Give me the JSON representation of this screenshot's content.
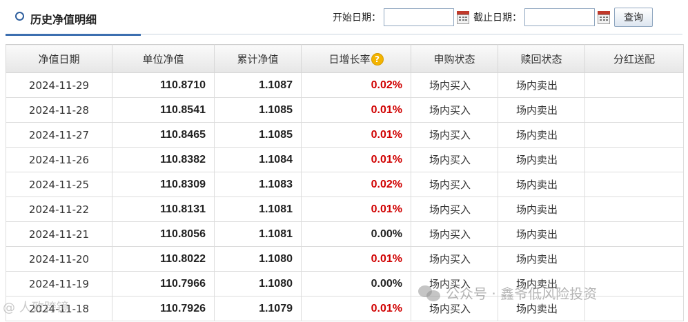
{
  "header": {
    "title": "历史净值明细",
    "start_label": "开始日期：",
    "end_label": "截止日期：",
    "start_value": "",
    "end_value": "",
    "query_label": "查询"
  },
  "table": {
    "columns": [
      "净值日期",
      "单位净值",
      "累计净值",
      "日增长率",
      "申购状态",
      "赎回状态",
      "分红送配"
    ],
    "help_glyph": "?",
    "rows": [
      {
        "date": "2024-11-29",
        "unit": "110.8710",
        "acc": "1.1087",
        "rate": "0.02%",
        "buy": "场内买入",
        "sell": "场内卖出",
        "div": ""
      },
      {
        "date": "2024-11-28",
        "unit": "110.8541",
        "acc": "1.1085",
        "rate": "0.01%",
        "buy": "场内买入",
        "sell": "场内卖出",
        "div": ""
      },
      {
        "date": "2024-11-27",
        "unit": "110.8465",
        "acc": "1.1085",
        "rate": "0.01%",
        "buy": "场内买入",
        "sell": "场内卖出",
        "div": ""
      },
      {
        "date": "2024-11-26",
        "unit": "110.8382",
        "acc": "1.1084",
        "rate": "0.01%",
        "buy": "场内买入",
        "sell": "场内卖出",
        "div": ""
      },
      {
        "date": "2024-11-25",
        "unit": "110.8309",
        "acc": "1.1083",
        "rate": "0.02%",
        "buy": "场内买入",
        "sell": "场内卖出",
        "div": ""
      },
      {
        "date": "2024-11-22",
        "unit": "110.8131",
        "acc": "1.1081",
        "rate": "0.01%",
        "buy": "场内买入",
        "sell": "场内卖出",
        "div": ""
      },
      {
        "date": "2024-11-21",
        "unit": "110.8056",
        "acc": "1.1081",
        "rate": "0.00%",
        "buy": "场内买入",
        "sell": "场内卖出",
        "div": ""
      },
      {
        "date": "2024-11-20",
        "unit": "110.8022",
        "acc": "1.1080",
        "rate": "0.01%",
        "buy": "场内买入",
        "sell": "场内卖出",
        "div": ""
      },
      {
        "date": "2024-11-19",
        "unit": "110.7966",
        "acc": "1.1080",
        "rate": "0.00%",
        "buy": "场内买入",
        "sell": "场内卖出",
        "div": ""
      },
      {
        "date": "2024-11-18",
        "unit": "110.7926",
        "acc": "1.1079",
        "rate": "0.01%",
        "buy": "场内买入",
        "sell": "场内卖出",
        "div": ""
      }
    ]
  },
  "watermark": {
    "text": "公众号 · 鑫爷低风险投资",
    "corner_text": "@ 人致跨镜"
  },
  "colors": {
    "positive": "#d00000",
    "neutral": "#222222",
    "accent": "#3d6fb0"
  },
  "icons": [
    "calendar-icon",
    "help-icon",
    "title-bullet-icon",
    "wechat-icon"
  ]
}
